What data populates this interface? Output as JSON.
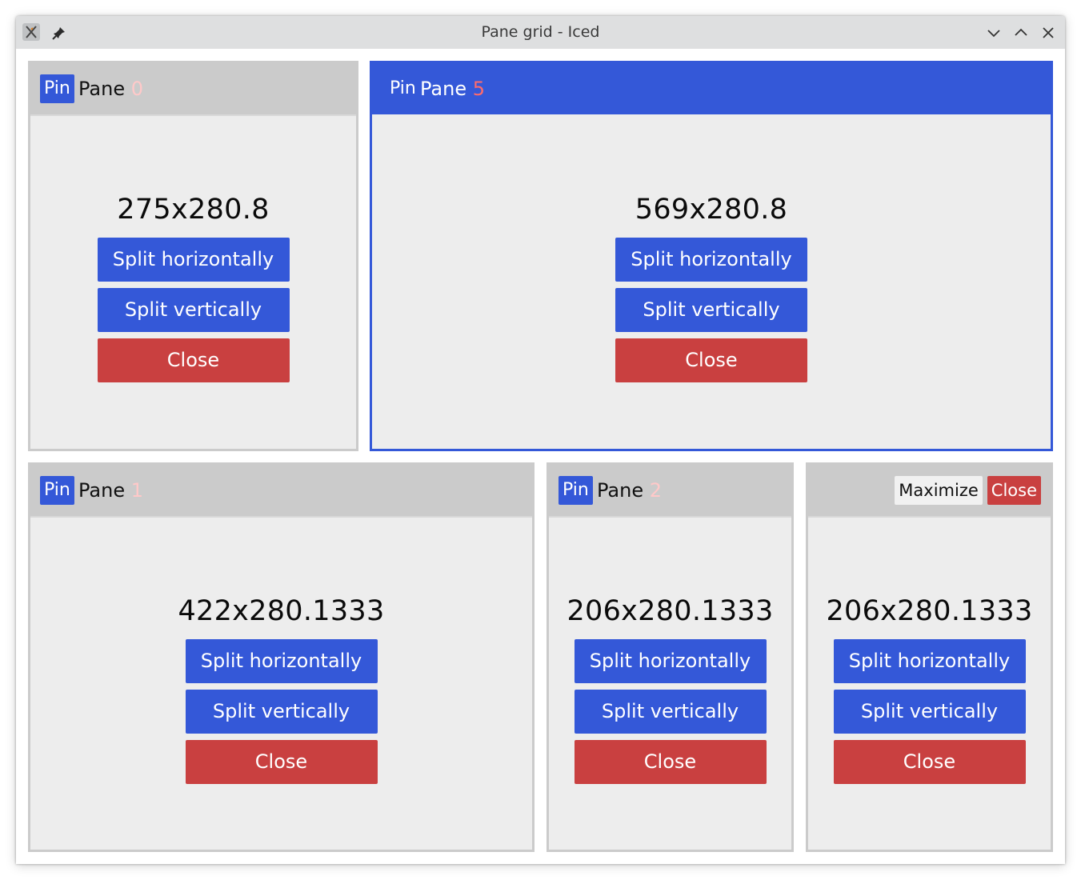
{
  "window": {
    "title": "Pane grid - Iced"
  },
  "labels": {
    "pin": "Pin",
    "pane": "Pane",
    "split_horizontally": "Split horizontally",
    "split_vertically": "Split vertically",
    "close": "Close",
    "maximize": "Maximize"
  },
  "panes": [
    {
      "id": "0",
      "size": "275x280.8",
      "focused": false
    },
    {
      "id": "5",
      "size": "569x280.8",
      "focused": true
    },
    {
      "id": "1",
      "size": "422x280.1333",
      "focused": false
    },
    {
      "id": "2",
      "size": "206x280.1333",
      "focused": false
    },
    {
      "id": "",
      "size": "206x280.1333",
      "focused": false
    }
  ],
  "colors": {
    "accent": "#3458d8",
    "danger": "#c94040",
    "pane_bg": "#ededed",
    "title_bar": "#cbcbcb",
    "focused_id": "#ff6b6b",
    "dim_id": "#ffc9c9"
  },
  "icons": {
    "app": "app-logo-icon",
    "pin": "pin-icon",
    "minimize": "chevron-down-icon",
    "maximize": "chevron-up-icon",
    "close": "close-icon"
  }
}
